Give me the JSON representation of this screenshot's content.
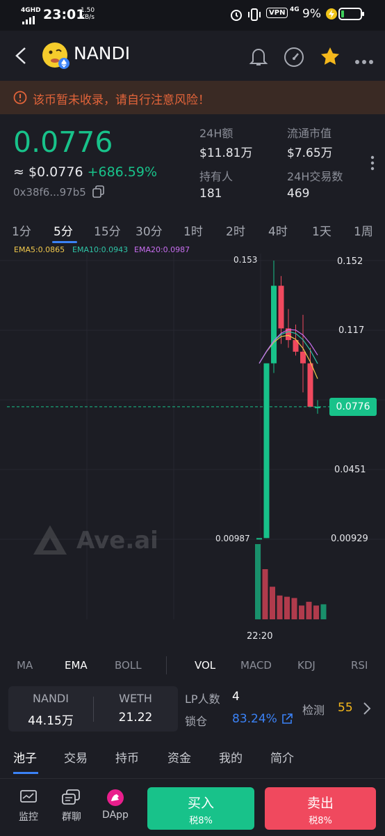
{
  "status": {
    "signal": "4GHD",
    "time": "23:01",
    "speed_val": "1.50",
    "speed_unit": "KB/s",
    "vpn": "VPN",
    "net": "4G",
    "battery_pct": "9%"
  },
  "header": {
    "title": "NANDI"
  },
  "warning": "该币暂未收录，请自行注意风险！",
  "price": {
    "current": "0.0776",
    "usd": "≈ $0.0776",
    "change": "+686.59%",
    "address": "0x38f6...97b5"
  },
  "stats": [
    {
      "label": "24H额",
      "value": "$11.81万"
    },
    {
      "label": "流通市值",
      "value": "$7.65万"
    },
    {
      "label": "持有人",
      "value": "181"
    },
    {
      "label": "24H交易数",
      "value": "469"
    }
  ],
  "timeframes": [
    "1分",
    "5分",
    "15分",
    "30分",
    "1时",
    "2时",
    "4时",
    "1天",
    "1周"
  ],
  "timeframe_active": "5分",
  "ema_legend": [
    "EMA5:0.0865",
    "EMA10:0.0943",
    "EMA20:0.0987"
  ],
  "chart_axis": {
    "y_labels": [
      "0.152",
      "0.117",
      "0.0451",
      "0.00929"
    ],
    "high_label": "0.153",
    "low_label": "0.00987",
    "current_label": "0.0776",
    "x_label": "22:20",
    "watermark": "Ave.ai"
  },
  "chart_data": {
    "type": "candlestick",
    "x_label": "22:20",
    "candles": [
      {
        "open": 0.00987,
        "high": 0.00987,
        "low": 0.00987,
        "close": 0.00987
      },
      {
        "open": 0.00987,
        "high": 0.1,
        "low": 0.00987,
        "close": 0.1
      },
      {
        "open": 0.1,
        "high": 0.153,
        "low": 0.095,
        "close": 0.14
      },
      {
        "open": 0.14,
        "high": 0.145,
        "low": 0.11,
        "close": 0.118
      },
      {
        "open": 0.118,
        "high": 0.128,
        "low": 0.108,
        "close": 0.112
      },
      {
        "open": 0.112,
        "high": 0.12,
        "low": 0.104,
        "close": 0.106
      },
      {
        "open": 0.106,
        "high": 0.125,
        "low": 0.085,
        "close": 0.1
      },
      {
        "open": 0.1,
        "high": 0.108,
        "low": 0.0776,
        "close": 0.0776
      },
      {
        "open": 0.0776,
        "high": 0.081,
        "low": 0.074,
        "close": 0.0776
      }
    ],
    "volume": [
      6,
      4,
      2.6,
      1.9,
      1.8,
      1.7,
      1.1,
      1.4,
      1.1,
      1.2
    ],
    "ema": {
      "EMA5": 0.0865,
      "EMA10": 0.0943,
      "EMA20": 0.0987
    },
    "ylim": [
      0.00929,
      0.153
    ]
  },
  "indicators": [
    "MA",
    "EMA",
    "BOLL",
    "VOL",
    "MACD",
    "KDJ",
    "RSI"
  ],
  "indicators_active": [
    "EMA",
    "VOL"
  ],
  "pool": {
    "token_a": "NANDI",
    "amount_a": "44.15万",
    "token_b": "WETH",
    "amount_b": "21.22"
  },
  "lp": {
    "count_label": "LP人数",
    "count": "4",
    "lock_label": "锁仓",
    "lock": "83.24%",
    "detect_label": "检测",
    "detect_score": "55"
  },
  "tabs": [
    "池子",
    "交易",
    "持币",
    "资金",
    "我的",
    "简介"
  ],
  "tab_active": "池子",
  "bottom_nav": [
    {
      "label": "监控",
      "icon": "monitor-icon"
    },
    {
      "label": "群聊",
      "icon": "chat-icon"
    },
    {
      "label": "DApp",
      "icon": "dapp-icon"
    }
  ],
  "actions": {
    "buy": "买入",
    "buy_tax": "税8%",
    "sell": "卖出",
    "sell_tax": "税8%",
    "buy_color": "#18c28a",
    "sell_color": "#f0495e"
  },
  "colors": {
    "up": "#18c28a",
    "down": "#f0495e",
    "bg": "#1c1d24"
  }
}
